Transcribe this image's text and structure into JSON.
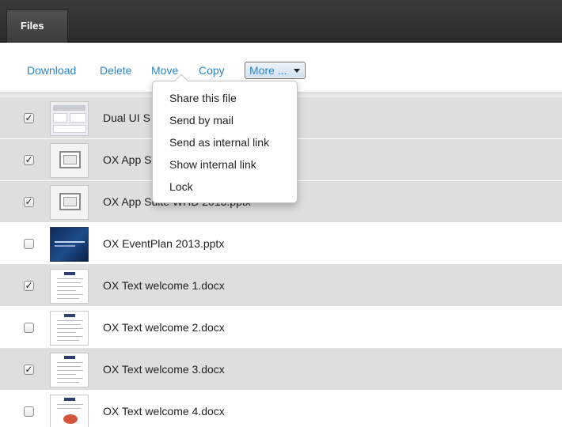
{
  "header": {
    "tab_label": "Files"
  },
  "toolbar": {
    "download": "Download",
    "delete": "Delete",
    "move": "Move",
    "copy": "Copy",
    "more": "More ..."
  },
  "more_menu": {
    "items": [
      "Share this file",
      "Send by mail",
      "Send as internal link",
      "Show internal link",
      "Lock"
    ]
  },
  "files": [
    {
      "name": "Dual UI S",
      "selected": true,
      "thumb": "ui-screenshot-thumb"
    },
    {
      "name": "OX App S",
      "selected": true,
      "thumb": "window-frame-thumb"
    },
    {
      "name": "OX App Suite WHD 2013.pptx",
      "selected": true,
      "thumb": "window-frame-thumb"
    },
    {
      "name": "OX EventPlan 2013.pptx",
      "selected": false,
      "thumb": "blue-slide-thumb"
    },
    {
      "name": "OX Text welcome 1.docx",
      "selected": true,
      "thumb": "document-thumb"
    },
    {
      "name": "OX Text welcome 2.docx",
      "selected": false,
      "thumb": "document-thumb"
    },
    {
      "name": "OX Text welcome 3.docx",
      "selected": true,
      "thumb": "document-thumb"
    },
    {
      "name": "OX Text welcome 4.docx",
      "selected": false,
      "thumb": "document-image-thumb"
    }
  ],
  "colors": {
    "link_blue": "#2a86c9",
    "header_dark": "#2b2b2b",
    "selected_row": "#dedede"
  },
  "icons": {
    "checkbox_checked": "✓",
    "dropdown_caret": "caret-down-icon"
  }
}
